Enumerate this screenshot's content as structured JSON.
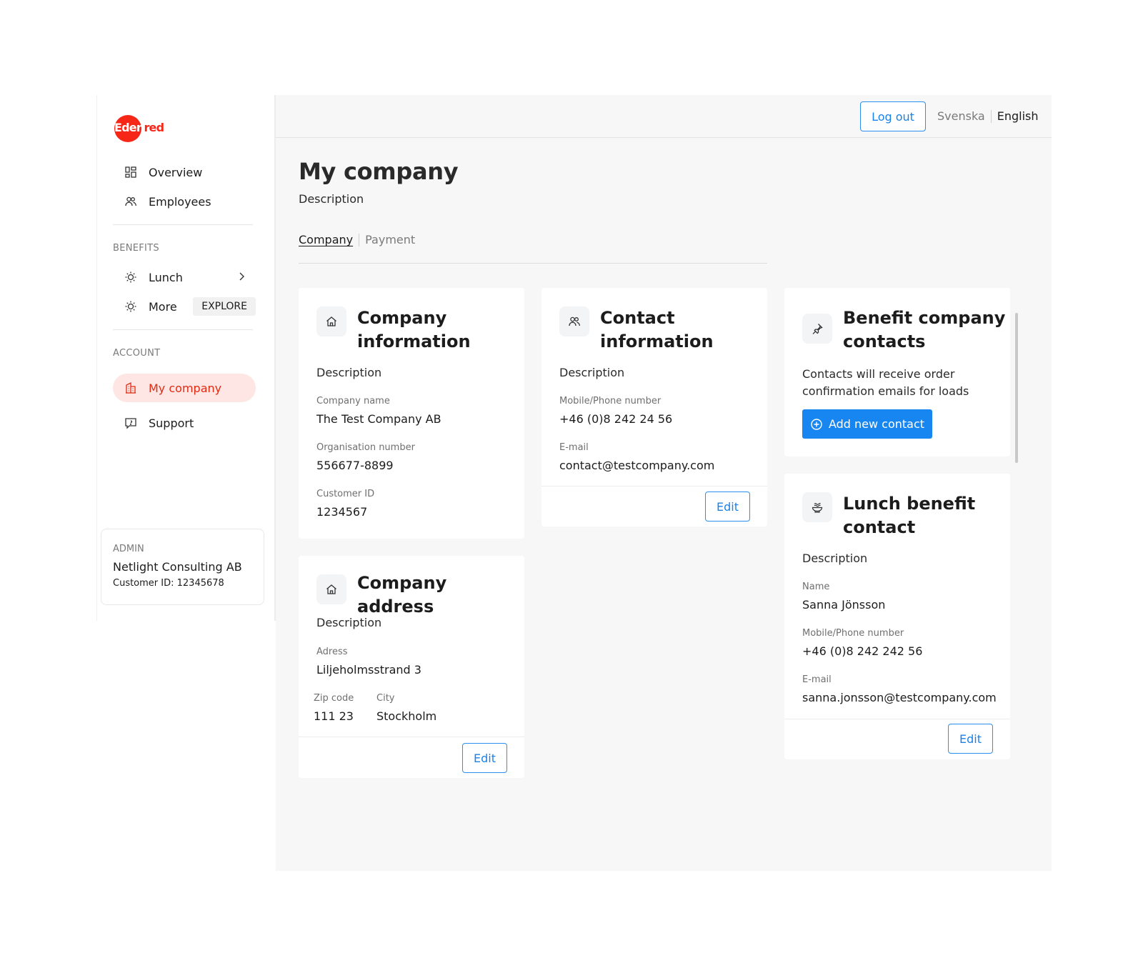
{
  "brand": {
    "logo_text_white": "Eden",
    "logo_text_red": "red",
    "color": "#f72717"
  },
  "sidebar": {
    "nav": [
      {
        "label": "Overview",
        "icon": "dashboard-icon"
      },
      {
        "label": "Employees",
        "icon": "users-icon"
      }
    ],
    "benefits_label": "BENEFITS",
    "benefits": [
      {
        "label": "Lunch",
        "icon": "sun-icon"
      },
      {
        "label": "More",
        "icon": "sun-icon",
        "badge": "EXPLORE"
      }
    ],
    "account_label": "ACCOUNT",
    "account": [
      {
        "label": "My company",
        "icon": "building-icon",
        "active": true
      },
      {
        "label": "Support",
        "icon": "chat-icon"
      }
    ],
    "admin": {
      "label": "ADMIN",
      "name": "Netlight Consulting AB",
      "customer_id": "Customer ID: 12345678"
    }
  },
  "topbar": {
    "logout": "Log out",
    "lang_sv": "Svenska",
    "lang_en": "English"
  },
  "page": {
    "title": "My company",
    "description": "Description",
    "tabs": [
      "Company",
      "Payment"
    ]
  },
  "cards": {
    "company_info": {
      "title_line1": "Company",
      "title_line2": "information",
      "description": "Description",
      "fields": [
        {
          "label": "Company name",
          "value": "The Test Company AB"
        },
        {
          "label": "Organisation number",
          "value": "556677-8899"
        },
        {
          "label": "Customer ID",
          "value": "1234567"
        }
      ]
    },
    "company_address": {
      "title": "Company address",
      "description": "Description",
      "address_label": "Adress",
      "address_value": "Liljeholmsstrand 3",
      "zip_label": "Zip code",
      "zip_value": "111 23",
      "city_label": "City",
      "city_value": "Stockholm",
      "edit": "Edit"
    },
    "contact_info": {
      "title_line1": "Contact",
      "title_line2": "information",
      "description": "Description",
      "phone_label": "Mobile/Phone number",
      "phone_value": "+46 (0)8 242 24 56",
      "email_label": "E-mail",
      "email_value": "contact@testcompany.com",
      "edit": "Edit"
    },
    "benefit_contacts": {
      "title_line1": "Benefit company",
      "title_line2": "contacts",
      "desc_line1": "Contacts will receive order",
      "desc_line2": "confirmation emails for loads",
      "add_button": "Add new contact"
    },
    "lunch_contact": {
      "title_line1": "Lunch benefit",
      "title_line2": "contact",
      "description": "Description",
      "name_label": "Name",
      "name_value": "Sanna Jönsson",
      "phone_label": "Mobile/Phone number",
      "phone_value": "+46 (0)8 242 242 56",
      "email_label": "E-mail",
      "email_value": "sanna.jonsson@testcompany.com",
      "edit": "Edit"
    }
  },
  "colors": {
    "accent_blue": "#1786f0",
    "active_red": "#e32b14",
    "active_bg": "#fde6e3"
  }
}
